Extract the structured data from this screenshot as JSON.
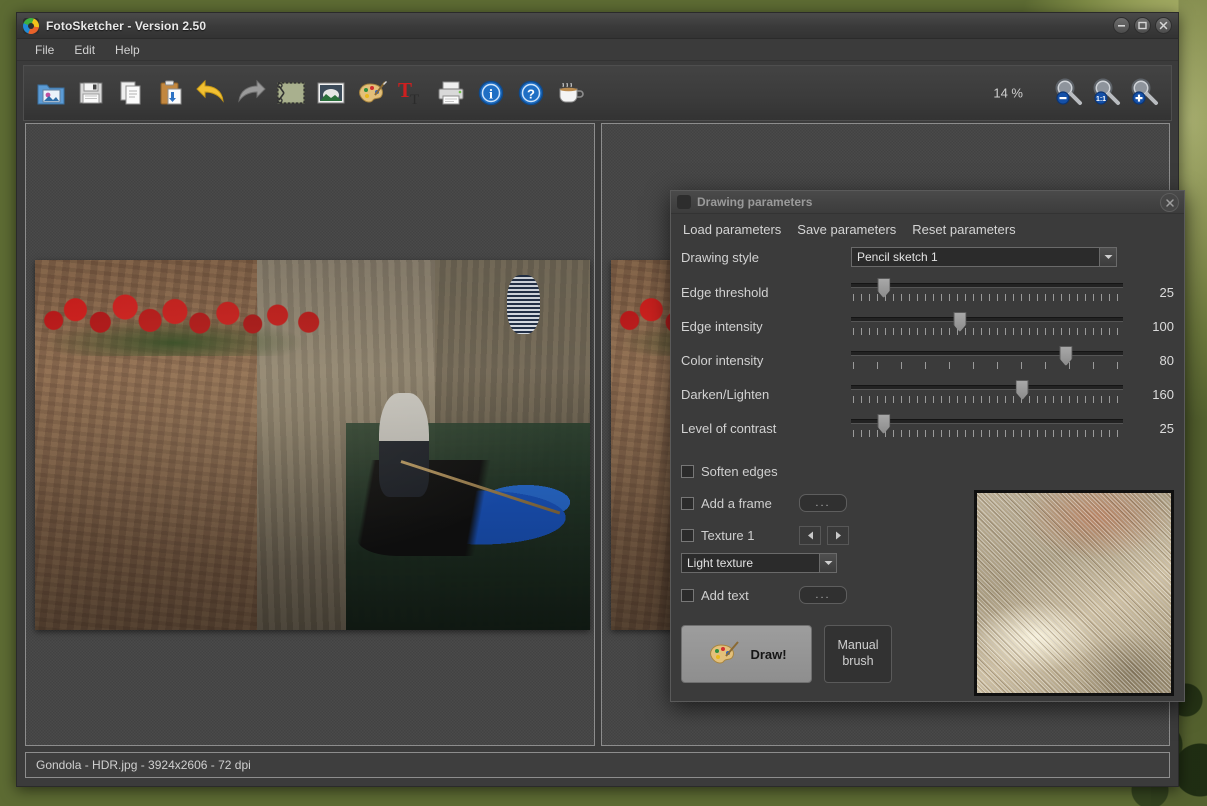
{
  "app": {
    "title": "FotoSketcher - Version 2.50",
    "logo_icon": "fotosketcher-logo-icon"
  },
  "window_controls": {
    "minimize": "minimize-icon",
    "maximize": "maximize-icon",
    "close": "close-icon"
  },
  "menubar": {
    "items": [
      {
        "label": "File"
      },
      {
        "label": "Edit"
      },
      {
        "label": "Help"
      }
    ]
  },
  "toolbar": {
    "zoom_percent": "14 %",
    "buttons": [
      {
        "name": "open-image-button",
        "icon": "folder-open-image-icon",
        "label": "Open"
      },
      {
        "name": "save-image-button",
        "icon": "floppy-disk-icon",
        "label": "Save"
      },
      {
        "name": "copy-button",
        "icon": "copy-pages-icon",
        "label": "Copy"
      },
      {
        "name": "paste-button",
        "icon": "clipboard-paste-icon",
        "label": "Paste"
      },
      {
        "name": "undo-button",
        "icon": "undo-arrow-icon",
        "label": "Undo"
      },
      {
        "name": "redo-button",
        "icon": "redo-arrow-icon",
        "label": "Redo"
      },
      {
        "name": "crop-button",
        "icon": "scissors-crop-icon",
        "label": "Crop"
      },
      {
        "name": "effects-button",
        "icon": "picture-icon",
        "label": "Image"
      },
      {
        "name": "drawing-parameters-button",
        "icon": "paint-palette-icon",
        "label": "Drawing parameters"
      },
      {
        "name": "add-text-button",
        "icon": "red-letter-t-icon",
        "label": "Add text"
      },
      {
        "name": "print-button",
        "icon": "printer-icon",
        "label": "Print"
      },
      {
        "name": "info-button",
        "icon": "info-circle-icon",
        "label": "Info"
      },
      {
        "name": "help-button",
        "icon": "question-circle-icon",
        "label": "Help"
      },
      {
        "name": "donate-button",
        "icon": "coffee-cup-icon",
        "label": "Donate"
      }
    ],
    "zoom_buttons": [
      {
        "name": "zoom-out-button",
        "icon": "magnifier-minus-icon"
      },
      {
        "name": "zoom-fit-button",
        "icon": "magnifier-fit-icon"
      },
      {
        "name": "zoom-in-button",
        "icon": "magnifier-plus-icon"
      }
    ]
  },
  "workarea": {
    "left_pane_name": "source-image-pane",
    "right_pane_name": "result-image-pane",
    "image_alt": "Venice canal gondola photo"
  },
  "statusbar": {
    "text": "Gondola - HDR.jpg - 3924x2606 - 72 dpi"
  },
  "dialog": {
    "title": "Drawing parameters",
    "logo_icon": "fotosketcher-logo-icon",
    "close_icon": "close-icon",
    "menu": [
      {
        "label": "Load parameters"
      },
      {
        "label": "Save parameters"
      },
      {
        "label": "Reset parameters"
      }
    ],
    "drawing_style": {
      "label": "Drawing style",
      "value": "Pencil sketch 1"
    },
    "sliders": [
      {
        "label": "Edge threshold",
        "value": "25",
        "percent": 12
      },
      {
        "label": "Edge intensity",
        "value": "100",
        "percent": 40
      },
      {
        "label": "Color intensity",
        "value": "80",
        "percent": 79
      },
      {
        "label": "Darken/Lighten",
        "value": "160",
        "percent": 63
      },
      {
        "label": "Level of contrast",
        "value": "25",
        "percent": 12
      }
    ],
    "options": {
      "soften_edges": {
        "label": "Soften edges",
        "checked": false
      },
      "add_frame": {
        "label": "Add a frame",
        "checked": false,
        "button": "..."
      },
      "texture": {
        "label": "Texture 1",
        "checked": false,
        "prev": "◀",
        "next": "▶"
      },
      "texture_type": {
        "value": "Light texture"
      },
      "add_text": {
        "label": "Add text",
        "checked": false,
        "button": "..."
      }
    },
    "buttons": {
      "draw": "Draw!",
      "draw_icon": "paint-palette-icon",
      "manual_brush_line1": "Manual",
      "manual_brush_line2": "brush"
    },
    "preview_name": "effect-preview-thumbnail"
  }
}
